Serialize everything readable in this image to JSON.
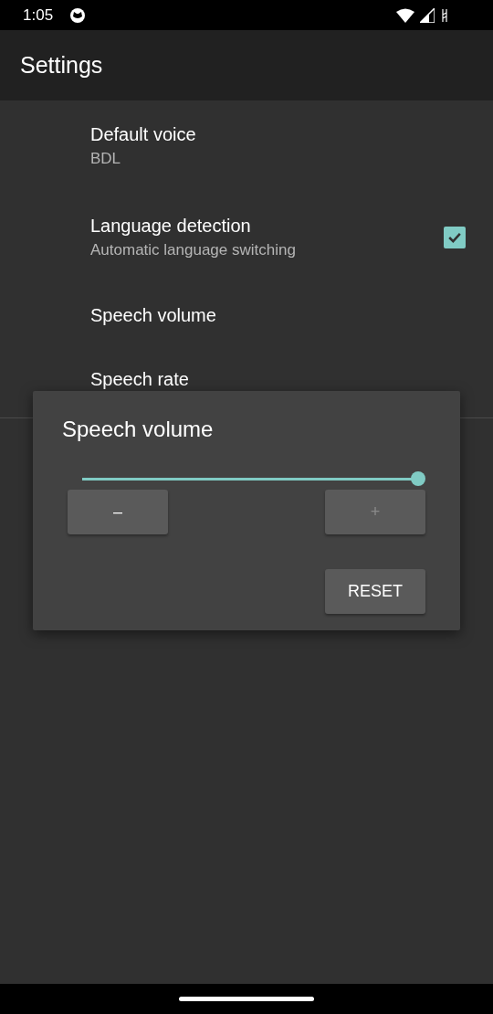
{
  "status_bar": {
    "time": "1:05"
  },
  "app_bar": {
    "title": "Settings"
  },
  "preferences": [
    {
      "kind": "text",
      "title": "Default voice",
      "summary": "BDL"
    },
    {
      "kind": "checkbox",
      "title": "Language detection",
      "summary": "Automatic language switching",
      "checked": true
    },
    {
      "kind": "text",
      "title": "Speech volume"
    },
    {
      "kind": "text",
      "title": "Speech rate"
    }
  ],
  "dialog": {
    "title": "Speech volume",
    "slider": {
      "level": 1.0
    },
    "buttons": [
      {
        "label": "–",
        "disabled": false
      },
      {
        "label": "+",
        "disabled": true
      }
    ],
    "reset": {
      "label": "RESET"
    }
  }
}
